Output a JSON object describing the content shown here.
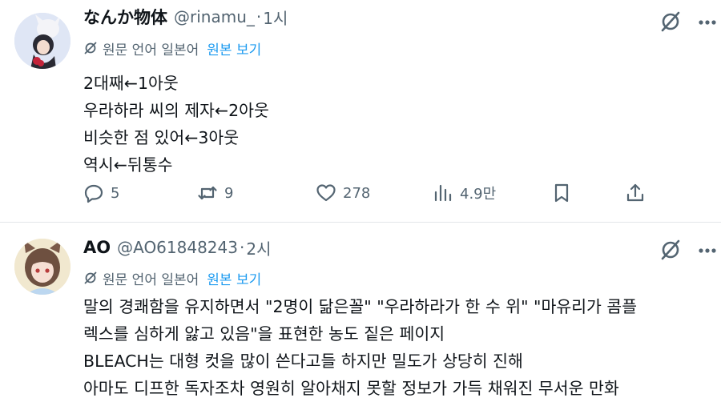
{
  "posts": [
    {
      "author_name": "なんか物体",
      "handle": "@rinamu_",
      "separator": "·",
      "time": "1시",
      "avatar_icon": "anime-avatar-icon",
      "translate": {
        "lang": "원문 언어 일본어",
        "show": "원본 보기"
      },
      "lines": [
        "2대째←1아웃",
        "우라하라 씨의 제자←2아웃",
        "비슷한 점 있어←3아웃",
        "역시←뒤통수"
      ],
      "actions": {
        "replies": "5",
        "reposts": "9",
        "likes": "278",
        "views": "4.9만"
      }
    },
    {
      "author_name": "AO",
      "handle": "@AO61848243",
      "separator": "·",
      "time": "2시",
      "avatar_icon": "anime-avatar-icon",
      "translate": {
        "lang": "원문 언어 일본어",
        "show": "원본 보기"
      },
      "lines": [
        "말의 경쾌함을 유지하면서 \"2명이 닮은꼴\" \"우라하라가 한 수 위\" \"마유리가 콤플",
        "렉스를 심하게 앓고 있음\"을 표현한 농도 짙은 페이지",
        "BLEACH는 대형 컷을 많이 쓴다고들 하지만 밀도가 상당히 진해",
        "아마도 디프한 독자조차 영원히 알아채지 못할 정보가 가득 채워진 무서운 만화"
      ]
    }
  ],
  "colors": {
    "text": "#0f1419",
    "muted": "#536471",
    "accent": "#1d9bf0",
    "divider": "#e3e6e9"
  }
}
